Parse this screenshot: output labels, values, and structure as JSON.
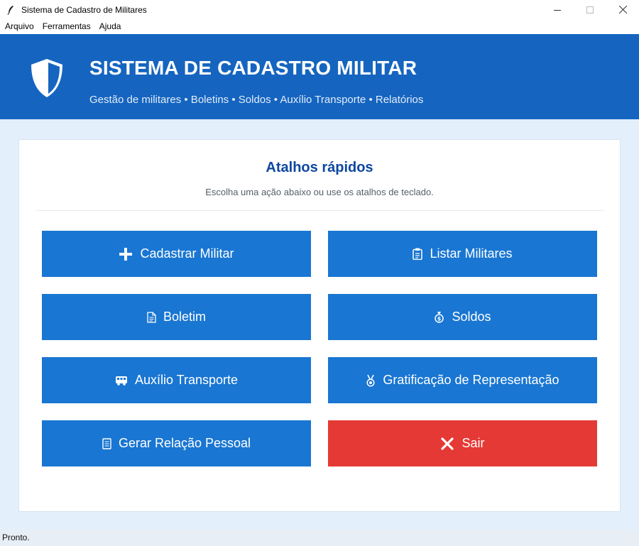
{
  "window": {
    "title": "Sistema de Cadastro de Militares"
  },
  "menu": [
    "Arquivo",
    "Ferramentas",
    "Ajuda"
  ],
  "header": {
    "title": "SISTEMA DE CADASTRO MILITAR",
    "subtitle": "Gestão de militares • Boletins • Soldos • Auxílio Transporte • Relatórios"
  },
  "card": {
    "title": "Atalhos rápidos",
    "subtitle": "Escolha uma ação abaixo ou use os atalhos de teclado."
  },
  "buttons": [
    {
      "label": "Cadastrar Militar",
      "icon": "plus-icon"
    },
    {
      "label": "Listar Militares",
      "icon": "clipboard-icon"
    },
    {
      "label": "Boletim",
      "icon": "document-icon"
    },
    {
      "label": "Soldos",
      "icon": "money-bag-icon"
    },
    {
      "label": "Auxílio Transporte",
      "icon": "bus-icon"
    },
    {
      "label": "Gratificação de Representação",
      "icon": "medal-icon"
    },
    {
      "label": "Gerar Relação Pessoal",
      "icon": "report-icon"
    },
    {
      "label": "Sair",
      "icon": "close-icon"
    }
  ],
  "status": "Pronto.",
  "colors": {
    "header": "#1565c0",
    "button": "#1976d2",
    "exit": "#e53935",
    "background": "#e3effb"
  }
}
